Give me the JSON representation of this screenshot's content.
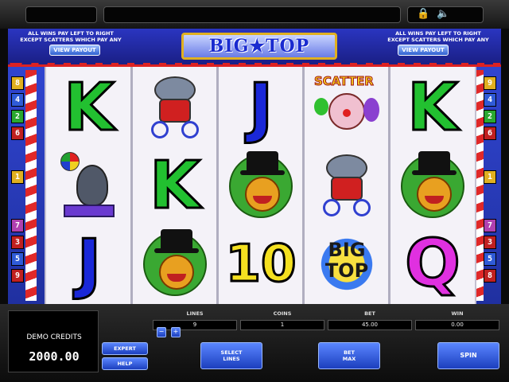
{
  "banner": {
    "rules_line1": "ALL WINS PAY LEFT TO RIGHT",
    "rules_line2": "EXCEPT SCATTERS WHICH PAY ANY",
    "view_payout": "VIEW PAYOUT",
    "logo": "BIG★TOP"
  },
  "icons": {
    "lock": "lock-icon",
    "sound": "speaker-icon"
  },
  "left_markers": [
    "8",
    "4",
    "2",
    "6",
    "1",
    "7",
    "3",
    "5",
    "9"
  ],
  "right_markers": [
    "9",
    "4",
    "2",
    "6",
    "1",
    "7",
    "3",
    "5",
    "8"
  ],
  "reels": [
    [
      "K",
      "seal",
      "J"
    ],
    [
      "elephant",
      "K",
      "lion"
    ],
    [
      "J",
      "lion",
      "10"
    ],
    [
      "scatter",
      "elephant",
      "bigtop"
    ],
    [
      "K",
      "lion",
      "Q"
    ]
  ],
  "symbol_text": {
    "scatter": "SCATTER",
    "bigtop_line1": "BIG",
    "bigtop_line2": "TOP"
  },
  "stats": {
    "lines_label": "LINES",
    "lines_value": "9",
    "coins_label": "COINS",
    "coins_value": "1",
    "bet_label": "BET",
    "bet_value": "45.00",
    "win_label": "WIN",
    "win_value": "0.00"
  },
  "credits": {
    "label": "DEMO CREDITS",
    "value": "2000.00"
  },
  "buttons": {
    "expert": "EXPERT",
    "help": "HELP",
    "select_lines_1": "SELECT",
    "select_lines_2": "LINES",
    "bet_max_1": "BET",
    "bet_max_2": "MAX",
    "spin": "SPIN"
  },
  "colors": {
    "accent_blue": "#2030a0",
    "pole_red": "#e02828",
    "K": "#22c030",
    "J": "#1a28d8",
    "10": "#f4e020",
    "Q": "#e030e0"
  }
}
